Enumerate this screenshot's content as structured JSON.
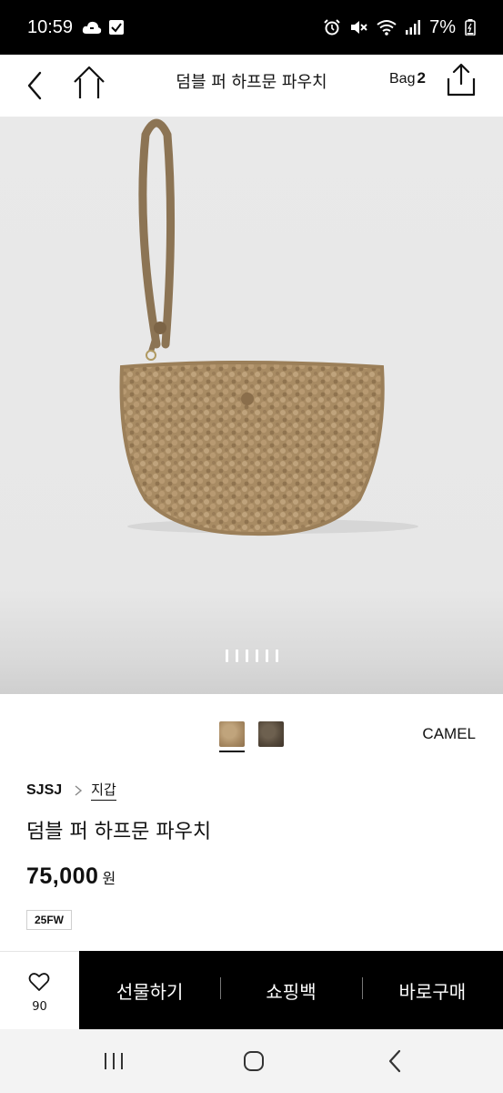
{
  "status_bar": {
    "time": "10:59",
    "battery": "7%",
    "icons": [
      "cloud-icon",
      "check-icon",
      "alarm-icon",
      "mute-icon",
      "wifi-icon",
      "signal-icon",
      "battery-icon"
    ]
  },
  "header": {
    "title": "덤블 퍼 하프문 파우치",
    "bag_label": "Bag",
    "bag_count": "2"
  },
  "gallery": {
    "image": "product-photo-pouch",
    "page_count": 6
  },
  "colors": {
    "selected_name": "CAMEL",
    "options": [
      "camel",
      "dark-brown"
    ],
    "swatch_colors": [
      "#a88a63",
      "#54483a"
    ]
  },
  "product": {
    "brand": "SJSJ",
    "category": "지갑",
    "name": "덤블 퍼 하프문 파우치",
    "price": "75,000",
    "currency": "원",
    "season": "25FW"
  },
  "actions": {
    "wish_count": "90",
    "gift": "선물하기",
    "cart": "쇼핑백",
    "buy_now": "바로구매"
  }
}
